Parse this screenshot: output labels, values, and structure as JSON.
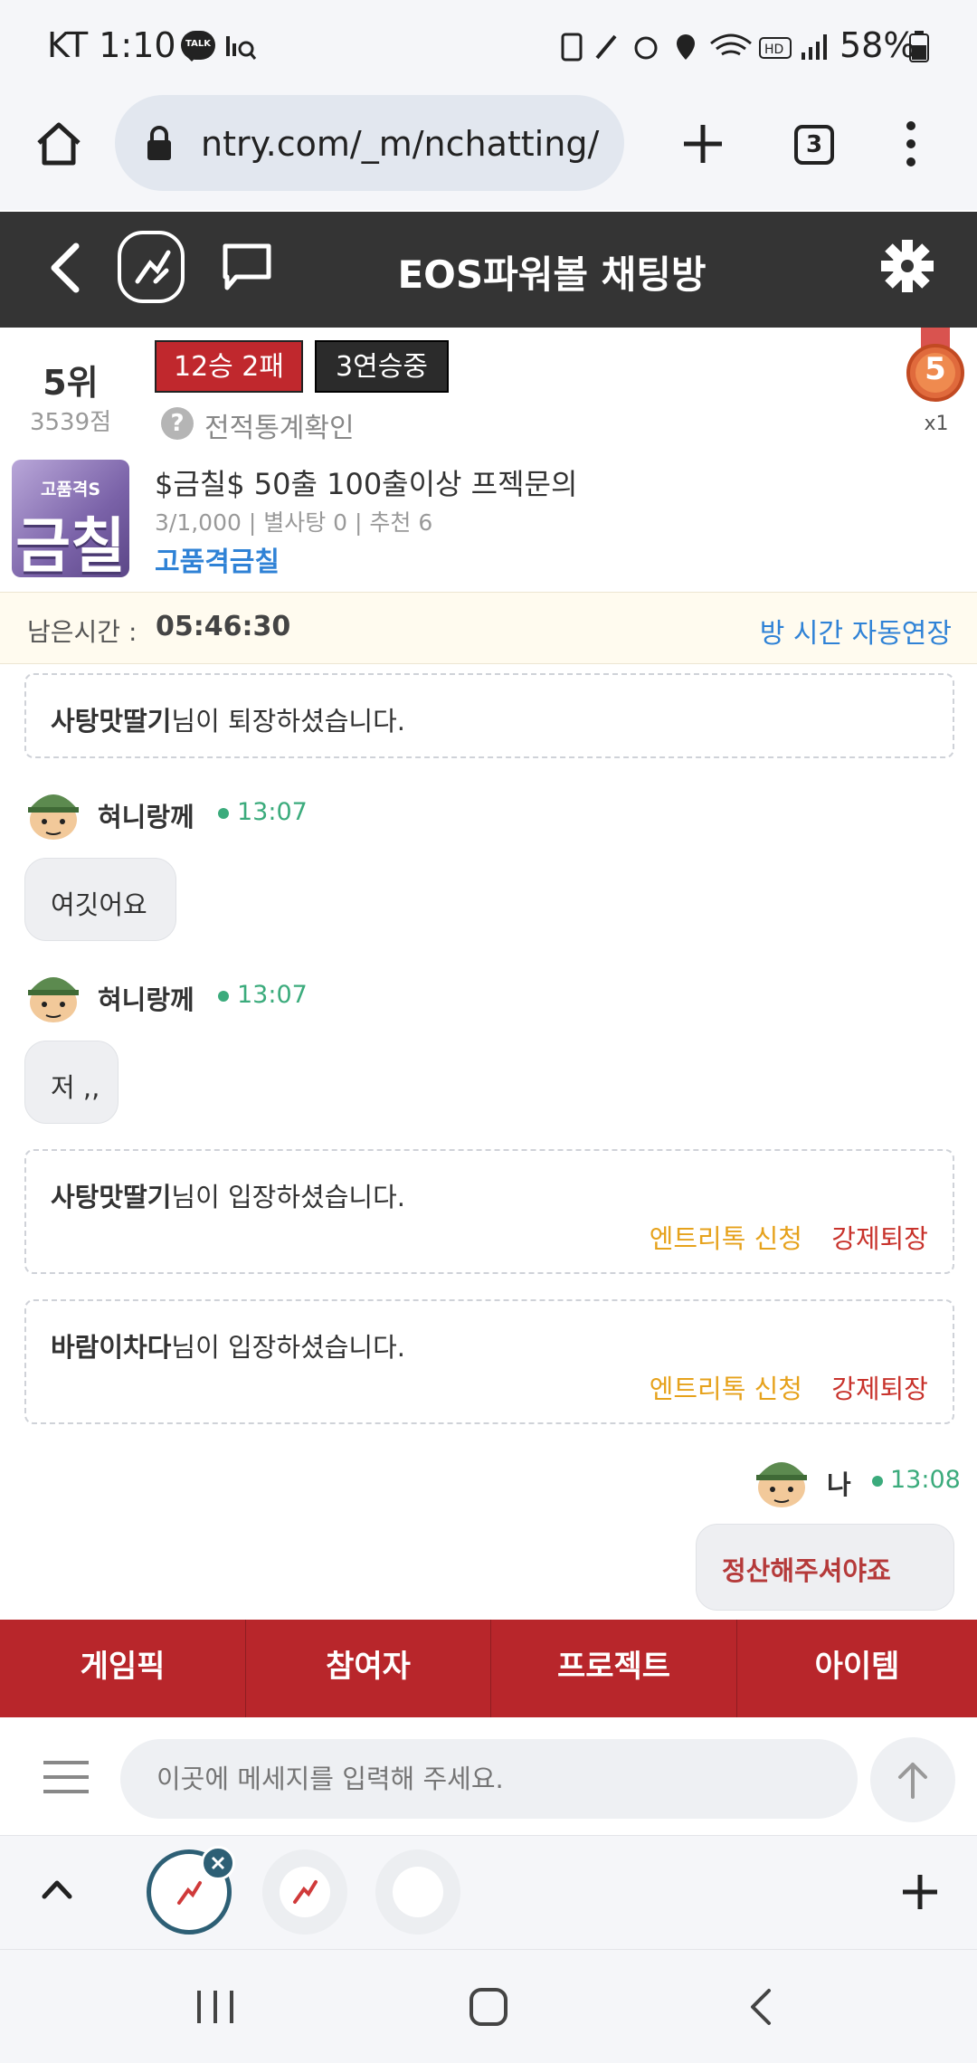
{
  "status_bar": {
    "carrier_time": "KT 1:10",
    "talk_badge": "TALK",
    "battery": "58%"
  },
  "browser": {
    "url": "ntry.com/_m/nchatting/",
    "tab_count": "3"
  },
  "header": {
    "title": "EOS파워볼 채팅방"
  },
  "rank": {
    "rank_label": "5위",
    "points": "3539점",
    "record_badge": "12승 2패",
    "streak_badge": "3연승중",
    "stats_link": "전적통계확인",
    "medal_number": "5",
    "medal_count": "x1"
  },
  "room": {
    "thumb_line1": "고품격S",
    "thumb_line2": "금칠",
    "title": "$금칠$ 50출 100출이상 프젝문의",
    "meta": "3/1,000 | 별사탕 0 | 추천 6",
    "owner": "고품격금칠"
  },
  "timer": {
    "label": "남은시간 :",
    "value": "05:46:30",
    "extend_link": "방 시간 자동연장"
  },
  "messages": {
    "sys1": {
      "nick": "사탕맛딸기",
      "text": "님이 퇴장하셨습니다."
    },
    "chat1": {
      "nick": "혀니랑께",
      "time": "13:07",
      "text": "여깃어요"
    },
    "chat2": {
      "nick": "혀니랑께",
      "time": "13:07",
      "text": "저 ,,"
    },
    "sys2": {
      "nick": "사탕맛딸기",
      "text": "님이 입장하셨습니다.",
      "action1": "엔트리톡 신청",
      "action2": "강제퇴장"
    },
    "sys3": {
      "nick": "바람이차다",
      "text": "님이 입장하셨습니다.",
      "action1": "엔트리톡 신청",
      "action2": "강제퇴장"
    },
    "mine": {
      "nick": "나",
      "time": "13:08",
      "text": "정산해주셔야죠"
    }
  },
  "tabs": [
    "게임픽",
    "참여자",
    "프로젝트",
    "아이템"
  ],
  "input": {
    "placeholder": "이곳에 메세지를 입력해 주세요."
  },
  "colors": {
    "header_bg": "#343434",
    "tab_bg": "#b8262b",
    "link_blue": "#2f82d6",
    "time_green": "#3bab7c",
    "entry_orange": "#e6a21c",
    "kick_red": "#c8332c"
  }
}
